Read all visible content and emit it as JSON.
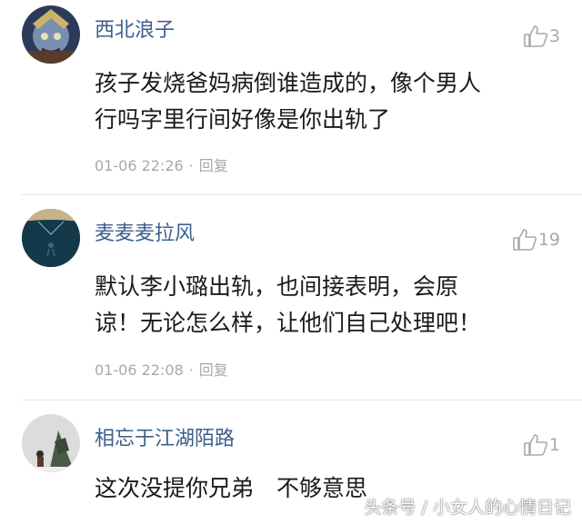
{
  "comments": [
    {
      "username": "西北浪子",
      "likes": "3",
      "lines": [
        "孩子发烧爸妈病倒谁造成的，像个男人",
        "行吗字里行间好像是你出轨了"
      ],
      "time": "01-06 22:26",
      "reply_label": "回复"
    },
    {
      "username": "麦麦麦拉风",
      "likes": "19",
      "lines": [
        "默认李小璐出轨，也间接表明，会原",
        "谅！无论怎么样，让他们自己处理吧！"
      ],
      "time": "01-06 22:08",
      "reply_label": "回复"
    },
    {
      "username": "相忘于江湖陌路",
      "likes": "1",
      "lines": [
        "这次没提你兄弟　不够意思"
      ]
    }
  ],
  "meta_separator": "·",
  "watermark": "头条号 / 小女人的心情日记",
  "colors": {
    "username": "#3d5f8c",
    "body_text": "#1a1a1a",
    "meta_text": "#a8a8a8",
    "like_icon": "#a9a9a9"
  }
}
